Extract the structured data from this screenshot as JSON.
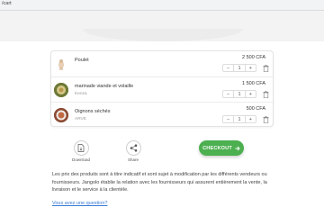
{
  "browser": {
    "url": "/cart"
  },
  "cart": {
    "items": [
      {
        "name": "Poulet",
        "vendor": "",
        "price": "2 500 CFA",
        "quantity": "1",
        "thumb_color": "#e6d5c3"
      },
      {
        "name": "marinade viande et volaille",
        "vendor": "Kenza",
        "price": "1 500 CFA",
        "quantity": "1",
        "thumb_color": "#b8a66a"
      },
      {
        "name": "Oignons séchés",
        "vendor": "ARVE",
        "price": "500 CFA",
        "quantity": "1",
        "thumb_color": "#b85a3c"
      }
    ],
    "minus_label": "−",
    "plus_label": "+"
  },
  "actions": {
    "download_label": "Download",
    "share_label": "Share",
    "checkout_label": "CHECKOUT",
    "checkout_color": "#4caf50"
  },
  "disclaimer": "Les prix des produits sont à titre indicatif et sont sujet à modification par les différents vendeurs ou fournisseurs. Jangolo établie la relation avec les fournisseurs qui assurent entièrement la vente, la livraison et le service à la clientèle.",
  "question_link": "Vous avez une question?"
}
